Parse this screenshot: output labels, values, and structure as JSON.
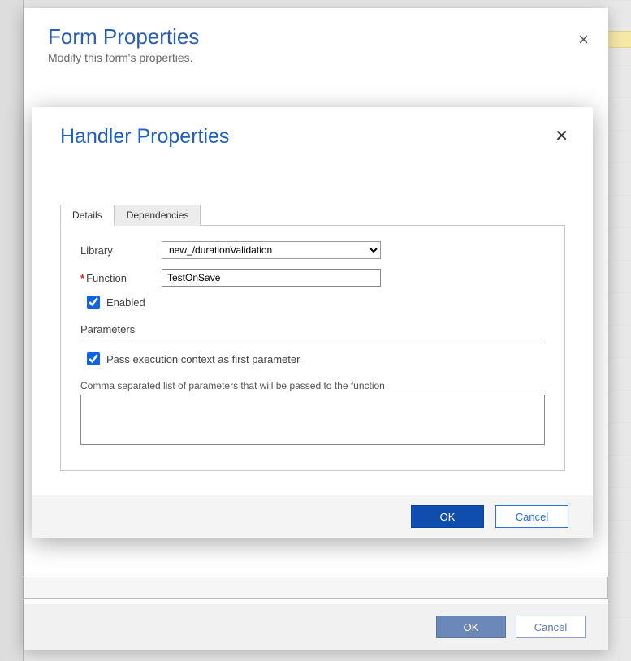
{
  "outer": {
    "title": "Form Properties",
    "subtitle": "Modify this form's properties.",
    "close_glyph": "×",
    "ok_label": "OK",
    "cancel_label": "Cancel"
  },
  "inner": {
    "title": "Handler Properties",
    "close_glyph": "✕",
    "tabs": {
      "details": "Details",
      "dependencies": "Dependencies"
    },
    "labels": {
      "library": "Library",
      "function": "Function",
      "enabled": "Enabled",
      "parameters_section": "Parameters",
      "pass_context": "Pass execution context as first parameter",
      "params_hint": "Comma separated list of parameters that will be passed to the function"
    },
    "values": {
      "library_selected": "new_/durationValidation",
      "function_value": "TestOnSave",
      "enabled_checked": true,
      "pass_context_checked": true,
      "params_text": ""
    },
    "ok_label": "OK",
    "cancel_label": "Cancel"
  }
}
